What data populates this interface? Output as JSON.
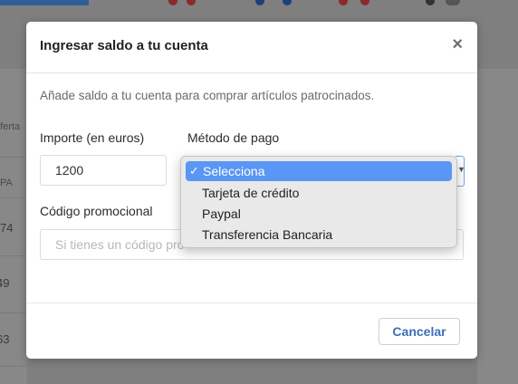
{
  "modal": {
    "title": "Ingresar saldo a tu cuenta",
    "close_glyph": "×",
    "description": "Añade saldo a tu cuenta para comprar artículos patrocinados.",
    "amount": {
      "label": "Importe (en euros)",
      "value": "1200"
    },
    "payment": {
      "label": "Método de pago",
      "options": [
        "Selecciona",
        "Tarjeta de crédito",
        "Paypal",
        "Transferencia Bancaria"
      ],
      "selected": "Selecciona",
      "check_glyph": "✓"
    },
    "promo": {
      "label": "Código promocional",
      "placeholder": "Si tienes un código pro"
    },
    "cancel_label": "Cancelar",
    "colors": {
      "accent": "#5a96f5",
      "link": "#3b6fb8"
    }
  },
  "background": {
    "partial_texts": [
      "oferta",
      "PA",
      "74",
      "49",
      "63"
    ]
  }
}
